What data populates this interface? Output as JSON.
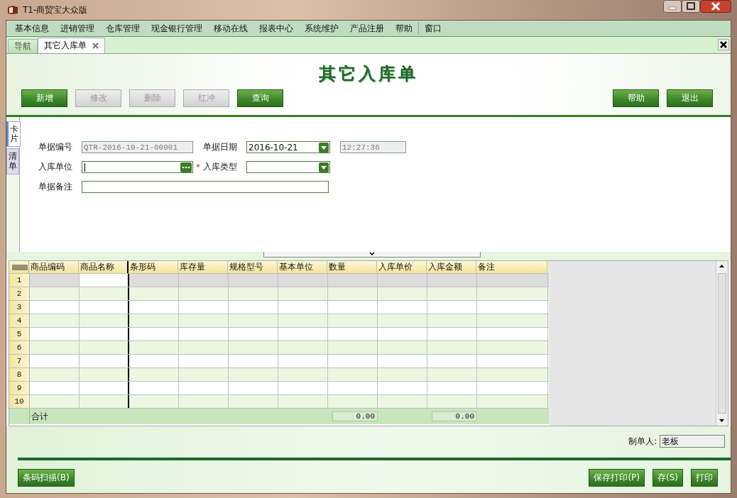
{
  "window": {
    "title": "T1-商贸宝大众版"
  },
  "menu": [
    "基本信息",
    "进销管理",
    "仓库管理",
    "现金银行管理",
    "移动在线",
    "报表中心",
    "系统维护",
    "产品注册",
    "帮助",
    "窗口"
  ],
  "tabs": [
    {
      "label": "导航",
      "selected": false
    },
    {
      "label": "其它入库单",
      "selected": true
    }
  ],
  "page_title": "其它入库单",
  "toolbar": [
    {
      "label": "新增",
      "disabled": false
    },
    {
      "label": "修改",
      "disabled": true
    },
    {
      "label": "删除",
      "disabled": true
    },
    {
      "label": "红冲",
      "disabled": true
    },
    {
      "label": "查询",
      "disabled": false
    }
  ],
  "toolbar_right": [
    {
      "label": "帮助",
      "disabled": false
    },
    {
      "label": "退出",
      "disabled": false
    }
  ],
  "side_tabs": [
    {
      "label": "卡片",
      "selected": true
    },
    {
      "label": "清单",
      "selected": false
    }
  ],
  "form": {
    "rows": [
      [
        {
          "label": "单据编号",
          "kind": "code",
          "value": "QTR-2016-10-21-00001",
          "disabled": true
        },
        {
          "label": "单据日期",
          "kind": "date",
          "value": "2016-10-21",
          "disabled": false
        },
        {
          "kind": "time",
          "value": "12:27:36",
          "disabled": true
        }
      ],
      [
        {
          "label": "入库单位",
          "kind": "lookup",
          "disabled": false,
          "focused": true,
          "required_mark": "*"
        },
        {
          "label": "入库类型",
          "kind": "date",
          "disabled": false
        }
      ],
      [
        {
          "label": "单据备注",
          "kind": "note",
          "disabled": false
        }
      ]
    ]
  },
  "grid": {
    "columns": [
      "商品编码",
      "商品名称",
      "条形码",
      "库存量",
      "规格型号",
      "基本单位",
      "数量",
      "入库单价",
      "入库金额",
      "备注"
    ],
    "rows": [
      {
        "number": "1",
        "selected": true
      },
      {
        "number": "2",
        "selected": false
      },
      {
        "number": "3",
        "selected": false
      },
      {
        "number": "4",
        "selected": false
      },
      {
        "number": "5",
        "selected": false
      },
      {
        "number": "6",
        "selected": false
      },
      {
        "number": "7",
        "selected": false
      },
      {
        "number": "8",
        "selected": false
      },
      {
        "number": "9",
        "selected": false
      },
      {
        "number": "10",
        "selected": false
      }
    ],
    "totals": {
      "label": "合计",
      "quantity": "0.00",
      "amount": "0.00"
    }
  },
  "maker": {
    "label": "制单人:",
    "value": "老板"
  },
  "bottom_left": [
    {
      "label": "条码扫描(B)"
    }
  ],
  "bottom_right": [
    {
      "label": "保存打印(P)"
    },
    {
      "label": "存(S)"
    },
    {
      "label": "打印"
    }
  ]
}
